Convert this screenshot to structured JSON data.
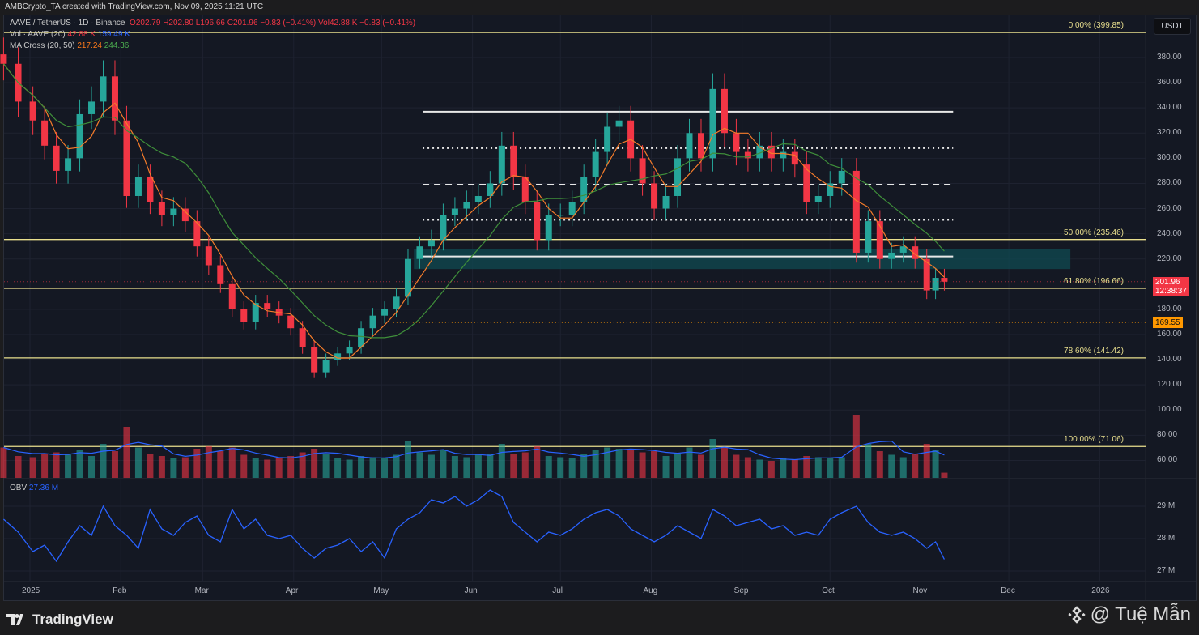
{
  "caption": "AMBCrypto_TA created with TradingView.com, Nov 09, 2025 11:21 UTC",
  "legend": {
    "symbol": "AAVE / TetherUS · 1D · Binance",
    "open": "O202.79",
    "high": "H202.80",
    "low": "L196.66",
    "close": "C201.96",
    "change": "−0.83 (−0.41%)",
    "vol": "Vol42.88 K",
    "vol_change": "−0.83 (−0.41%)",
    "vol_ind": "Vol · AAVE (20)",
    "vol_val": "42.88 K",
    "vol_ma": "159.49 K",
    "ma_cross": "MA Cross (20, 50)",
    "ma20": "217.24",
    "ma50": "244.36",
    "obv": "OBV",
    "obv_val": "27.36 M"
  },
  "currency_button": "USDT",
  "price_tag": {
    "price": "201.96",
    "countdown": "12:38:37",
    "color": "#f23645"
  },
  "level_tag": {
    "price": "169.55",
    "color": "#ff9800"
  },
  "footer": {
    "brand": "TradingView",
    "watermark": "@ Tuệ Mẫn"
  },
  "colors": {
    "up": "#26a69a",
    "down": "#f23645",
    "ma20": "#f57c2a",
    "ma50": "#3f8f3a",
    "fib": "#e9df8e",
    "obv": "#2962ff",
    "zone": "#0f4a52"
  },
  "chart_data": {
    "type": "candlestick",
    "symbol": "AAVE/USDT",
    "ylim": [
      50,
      400
    ],
    "y_ticks": [
      "380.00",
      "360.00",
      "340.00",
      "320.00",
      "300.00",
      "280.00",
      "260.00",
      "240.00",
      "220.00",
      "180.00",
      "160.00",
      "140.00",
      "120.00",
      "100.00",
      "80.00",
      "60.00"
    ],
    "x_ticks": [
      {
        "label": "2025",
        "date": "2025-01-01"
      },
      {
        "label": "Feb",
        "date": "2025-02-01"
      },
      {
        "label": "Mar",
        "date": "2025-03-01"
      },
      {
        "label": "Apr",
        "date": "2025-04-01"
      },
      {
        "label": "May",
        "date": "2025-05-01"
      },
      {
        "label": "Jun",
        "date": "2025-06-01"
      },
      {
        "label": "Jul",
        "date": "2025-07-01"
      },
      {
        "label": "Aug",
        "date": "2025-08-01"
      },
      {
        "label": "Sep",
        "date": "2025-09-01"
      },
      {
        "label": "Oct",
        "date": "2025-10-01"
      },
      {
        "label": "Nov",
        "date": "2025-11-01"
      },
      {
        "label": "Dec",
        "date": "2025-12-01"
      },
      {
        "label": "2026",
        "date": "2026-01-01"
      }
    ],
    "fib_levels": [
      {
        "label": "0.00% (399.85)",
        "price": 399.85
      },
      {
        "label": "50.00% (235.46)",
        "price": 235.46
      },
      {
        "label": "61.80% (196.66)",
        "price": 196.66
      },
      {
        "label": "78.60% (141.42)",
        "price": 141.42
      },
      {
        "label": "100.00% (71.06)",
        "price": 71.06
      }
    ],
    "range_lines": [
      {
        "price": 337,
        "style": "solid",
        "from": "2025-05-15",
        "to": "2025-11-12"
      },
      {
        "price": 308,
        "style": "dotted",
        "from": "2025-05-15",
        "to": "2025-11-12"
      },
      {
        "price": 279,
        "style": "dashed",
        "from": "2025-05-15",
        "to": "2025-11-12"
      },
      {
        "price": 251,
        "style": "dotted",
        "from": "2025-05-15",
        "to": "2025-11-12"
      },
      {
        "price": 222,
        "style": "solid",
        "from": "2025-05-15",
        "to": "2025-11-12"
      }
    ],
    "support_zone": {
      "low": 212,
      "high": 228,
      "from": "2025-05-12",
      "to": "2025-12-22"
    },
    "dotted_level": {
      "price": 169.55,
      "from": "2025-05-05"
    },
    "obv_ticks": [
      {
        "label": "29 M",
        "value": 29
      },
      {
        "label": "28 M",
        "value": 28
      },
      {
        "label": "27 M",
        "value": 27
      }
    ],
    "points": [
      [
        "2024-12-23",
        375,
        250,
        28.6
      ],
      [
        "2024-12-28",
        345,
        180,
        28.2
      ],
      [
        "2025-01-02",
        330,
        170,
        27.6
      ],
      [
        "2025-01-06",
        310,
        200,
        27.8
      ],
      [
        "2025-01-10",
        290,
        210,
        27.3
      ],
      [
        "2025-01-14",
        300,
        190,
        27.9
      ],
      [
        "2025-01-18",
        335,
        230,
        28.4
      ],
      [
        "2025-01-22",
        345,
        180,
        28.1
      ],
      [
        "2025-01-26",
        365,
        280,
        29.0
      ],
      [
        "2025-01-30",
        330,
        220,
        28.4
      ],
      [
        "2025-02-03",
        270,
        420,
        28.1
      ],
      [
        "2025-02-07",
        285,
        250,
        27.7
      ],
      [
        "2025-02-11",
        265,
        200,
        28.9
      ],
      [
        "2025-02-15",
        255,
        180,
        28.3
      ],
      [
        "2025-02-19",
        260,
        160,
        28.1
      ],
      [
        "2025-02-23",
        250,
        170,
        28.5
      ],
      [
        "2025-02-27",
        230,
        240,
        28.7
      ],
      [
        "2025-03-03",
        215,
        260,
        28.1
      ],
      [
        "2025-03-07",
        200,
        220,
        27.9
      ],
      [
        "2025-03-11",
        180,
        250,
        28.9
      ],
      [
        "2025-03-15",
        170,
        190,
        28.3
      ],
      [
        "2025-03-19",
        185,
        160,
        28.6
      ],
      [
        "2025-03-23",
        180,
        150,
        28.1
      ],
      [
        "2025-03-27",
        175,
        170,
        28.0
      ],
      [
        "2025-03-31",
        165,
        180,
        28.1
      ],
      [
        "2025-04-04",
        150,
        210,
        27.7
      ],
      [
        "2025-04-08",
        130,
        240,
        27.4
      ],
      [
        "2025-04-12",
        140,
        200,
        27.7
      ],
      [
        "2025-04-16",
        145,
        160,
        27.8
      ],
      [
        "2025-04-20",
        150,
        150,
        28.0
      ],
      [
        "2025-04-24",
        165,
        180,
        27.6
      ],
      [
        "2025-04-28",
        175,
        170,
        27.9
      ],
      [
        "2025-05-02",
        180,
        160,
        27.4
      ],
      [
        "2025-05-06",
        190,
        190,
        28.3
      ],
      [
        "2025-05-10",
        220,
        300,
        28.6
      ],
      [
        "2025-05-14",
        230,
        210,
        28.8
      ],
      [
        "2025-05-18",
        235,
        190,
        29.2
      ],
      [
        "2025-05-22",
        255,
        230,
        29.1
      ],
      [
        "2025-05-26",
        260,
        180,
        29.3
      ],
      [
        "2025-05-30",
        265,
        170,
        29.0
      ],
      [
        "2025-06-03",
        270,
        190,
        29.2
      ],
      [
        "2025-06-07",
        280,
        200,
        29.5
      ],
      [
        "2025-06-11",
        310,
        280,
        29.3
      ],
      [
        "2025-06-15",
        285,
        200,
        28.5
      ],
      [
        "2025-06-19",
        265,
        210,
        28.2
      ],
      [
        "2025-06-23",
        235,
        260,
        27.9
      ],
      [
        "2025-06-27",
        255,
        180,
        28.2
      ],
      [
        "2025-07-01",
        255,
        170,
        28.1
      ],
      [
        "2025-07-05",
        265,
        160,
        28.3
      ],
      [
        "2025-07-09",
        285,
        200,
        28.6
      ],
      [
        "2025-07-13",
        305,
        230,
        28.8
      ],
      [
        "2025-07-17",
        325,
        250,
        28.9
      ],
      [
        "2025-07-21",
        330,
        240,
        28.7
      ],
      [
        "2025-07-25",
        300,
        230,
        28.3
      ],
      [
        "2025-07-29",
        280,
        210,
        28.1
      ],
      [
        "2025-08-02",
        260,
        220,
        27.9
      ],
      [
        "2025-08-06",
        270,
        180,
        28.1
      ],
      [
        "2025-08-10",
        300,
        200,
        28.4
      ],
      [
        "2025-08-14",
        320,
        250,
        28.2
      ],
      [
        "2025-08-18",
        300,
        190,
        28.0
      ],
      [
        "2025-08-22",
        355,
        320,
        28.9
      ],
      [
        "2025-08-26",
        320,
        250,
        28.7
      ],
      [
        "2025-08-30",
        305,
        190,
        28.4
      ],
      [
        "2025-09-03",
        300,
        170,
        28.5
      ],
      [
        "2025-09-07",
        310,
        150,
        28.6
      ],
      [
        "2025-09-11",
        300,
        140,
        28.3
      ],
      [
        "2025-09-15",
        305,
        160,
        28.4
      ],
      [
        "2025-09-19",
        295,
        150,
        28.1
      ],
      [
        "2025-09-23",
        265,
        180,
        28.2
      ],
      [
        "2025-09-27",
        270,
        170,
        28.1
      ],
      [
        "2025-10-01",
        280,
        160,
        28.6
      ],
      [
        "2025-10-05",
        290,
        170,
        28.8
      ],
      [
        "2025-10-10",
        225,
        520,
        29.0
      ],
      [
        "2025-10-14",
        250,
        280,
        28.5
      ],
      [
        "2025-10-18",
        220,
        220,
        28.2
      ],
      [
        "2025-10-22",
        225,
        190,
        28.1
      ],
      [
        "2025-10-26",
        230,
        170,
        28.2
      ],
      [
        "2025-10-30",
        220,
        200,
        28.0
      ],
      [
        "2025-11-03",
        195,
        280,
        27.7
      ],
      [
        "2025-11-06",
        205,
        230,
        27.9
      ],
      [
        "2025-11-09",
        201.96,
        42.88,
        27.36
      ]
    ],
    "point_fields": [
      "date",
      "close",
      "volume_k",
      "obv_m"
    ]
  }
}
